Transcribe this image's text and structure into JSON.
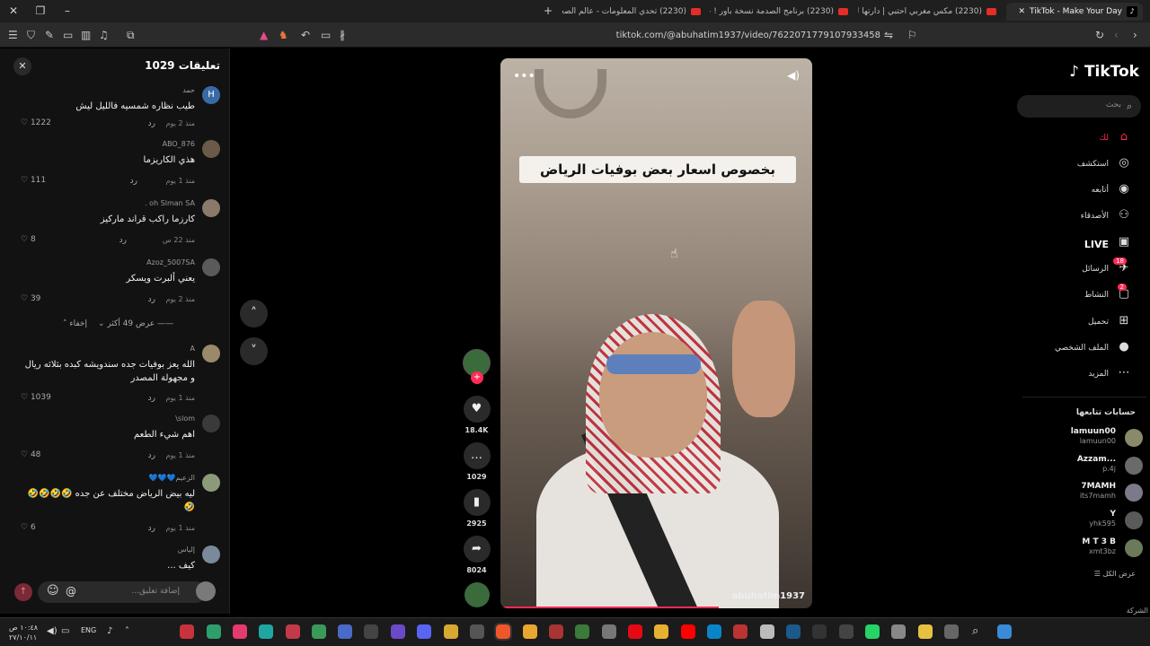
{
  "browser": {
    "tabs": [
      {
        "title": "TikTok - Make Your Day",
        "active": true
      },
      {
        "title": "(2230) مكس مغربي احتبي | دارتها لي",
        "active": false
      },
      {
        "title": "(2230) برنامج الصدمة نسخة باور ! - be",
        "active": false
      },
      {
        "title": "(2230) تحدي المعلومات - عالم الصحابة",
        "active": false
      }
    ],
    "new_tab": "+",
    "url": "tiktok.com/@abuhatim1937/video/7622071779107933458"
  },
  "comments": {
    "header": "تعليقات 1029",
    "items": [
      {
        "avatar_letter": "H",
        "name": "حمد",
        "text": "طيب نظاره شمسيه فالليل ليش",
        "time": "منذ 2 يوم",
        "reply": "رد",
        "likes": "1222"
      },
      {
        "avatar_letter": "",
        "name": "ABO_876",
        "text": "هذي الكاريزما",
        "time": "منذ 1 يوم",
        "reply": "رد",
        "likes": "111"
      },
      {
        "avatar_letter": "",
        "name": "oh Slman SA .",
        "text": "كارزما راكب قراند ماركيز",
        "time": "منذ 22 س",
        "reply": "رد",
        "likes": "8"
      },
      {
        "avatar_letter": "",
        "name": "Azoz_5007SA",
        "text": "يعني ألبرت ويسكر",
        "time": "منذ 2 يوم",
        "reply": "رد",
        "likes": "39"
      }
    ],
    "show_more": "عرض 49 أكثر",
    "hide": "إخفاء",
    "items2": [
      {
        "name": "A",
        "text": "الله يعز بوفيات جده سندويشه كبده بثلاثه ريال و مجهولة المصدر",
        "time": "منذ 1 يوم",
        "reply": "رد",
        "likes": "1039"
      },
      {
        "name": "slom\\",
        "text": "اهم شيء الطعم",
        "time": "منذ 1 يوم",
        "reply": "رد",
        "likes": "48"
      },
      {
        "name": "الزعيم💙💙💙",
        "text": "ليه بيض الرياض مختلف عن جده 🤣🤣🤣🤣🤣",
        "time": "منذ 1 يوم",
        "reply": "رد",
        "likes": "6"
      },
      {
        "name": "إلياس",
        "text": "كيف ...",
        "time": "",
        "reply": "",
        "likes": ""
      }
    ],
    "input_placeholder": "إضافة تعليق...",
    "mention": "@"
  },
  "video": {
    "caption_overlay": "بخصوص اسعار بعض بوفيات الرياض",
    "handle": "abuhatim1937",
    "progress": 0.7,
    "stats": {
      "likes": "18.4K",
      "comments": "1029",
      "saves": "2925",
      "shares": "8024"
    }
  },
  "sidebar": {
    "logo": "TikTok",
    "search_placeholder": "بحث",
    "nav": [
      {
        "label": "لك",
        "icon": "home-icon"
      },
      {
        "label": "استكشف",
        "icon": "compass-icon"
      },
      {
        "label": "أتابعه",
        "icon": "following-icon"
      },
      {
        "label": "الأصدقاء",
        "icon": "friends-icon"
      },
      {
        "label": "LIVE",
        "icon": "live-icon"
      },
      {
        "label": "الرسائل",
        "icon": "messages-icon",
        "badge": "18"
      },
      {
        "label": "النشاط",
        "icon": "activity-icon",
        "badge": "2"
      },
      {
        "label": "تحميل",
        "icon": "upload-icon"
      },
      {
        "label": "الملف الشخصي",
        "icon": "profile-icon"
      },
      {
        "label": "المزيد",
        "icon": "more-icon"
      }
    ],
    "following_title": "حسابات تتابعها",
    "following": [
      {
        "name": "lamuun00",
        "user": "lamuun00"
      },
      {
        "name": "Azzam...",
        "user": "p.4j"
      },
      {
        "name": "7MAMH",
        "user": "its7mamh"
      },
      {
        "name": "Y",
        "user": "yhk595"
      },
      {
        "name": "M T 3 B",
        "user": "xmt3bz"
      }
    ],
    "see_all": "عرض الكل",
    "company": "الشركة"
  },
  "taskbar": {
    "time": "١٠:٤٨ ص",
    "date": "٢٧/١٠/١١",
    "lang": "ENG"
  }
}
